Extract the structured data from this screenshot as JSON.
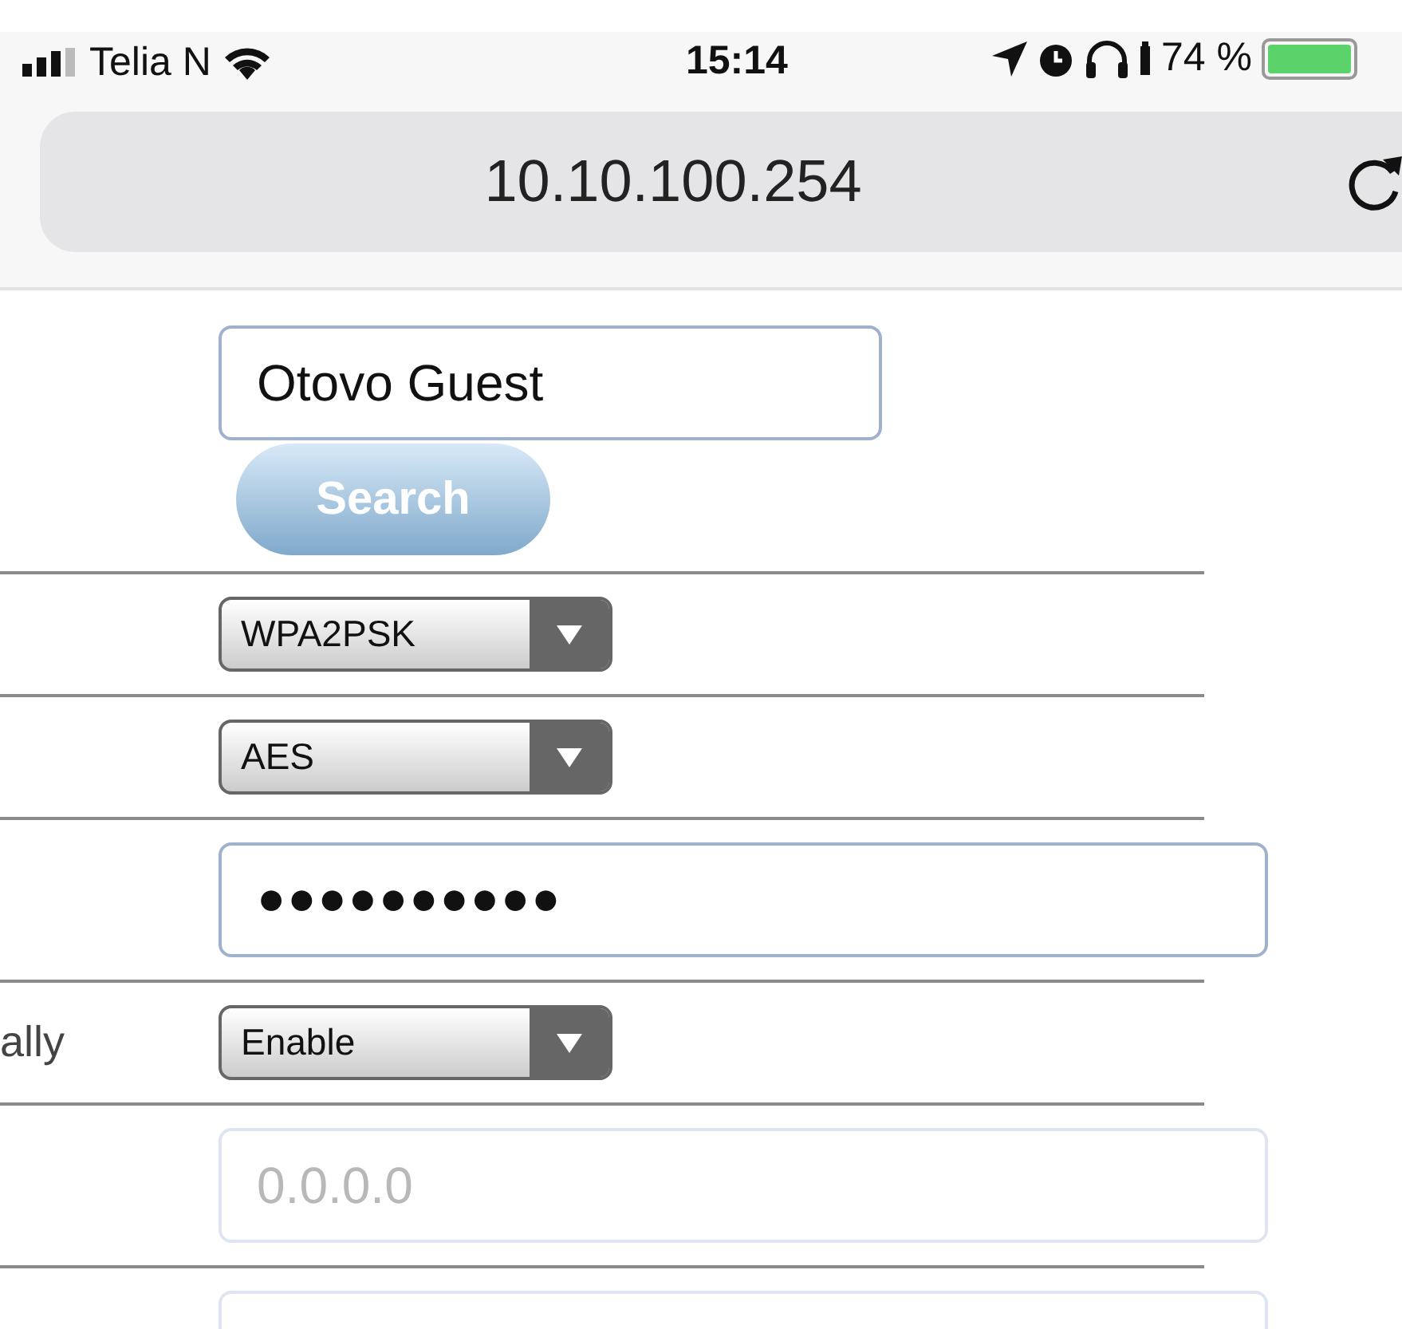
{
  "status_bar": {
    "carrier": "Telia N",
    "time": "15:14",
    "battery": "74 %"
  },
  "address_bar": {
    "url": "10.10.100.254"
  },
  "form": {
    "rows": [
      {
        "kind": "text",
        "value": "Otovo Guest",
        "button": "Search",
        "disabled": false
      },
      {
        "kind": "select",
        "value": "WPA2PSK"
      },
      {
        "kind": "select",
        "value": "AES"
      },
      {
        "kind": "password",
        "value": "●●●●●●●●●●",
        "disabled": false
      },
      {
        "kind": "select",
        "label": "ally",
        "value": "Enable"
      },
      {
        "kind": "text",
        "placeholder": "0.0.0.0",
        "disabled": true
      },
      {
        "kind": "text",
        "disabled": true
      }
    ]
  }
}
